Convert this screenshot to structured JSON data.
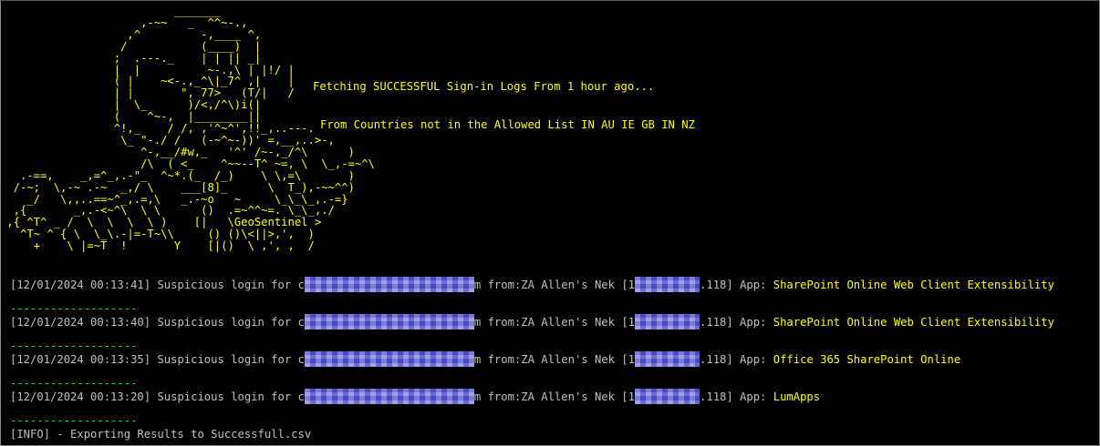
{
  "terminal": {
    "ascii_art": "                          _______\n                     ,-~~   _  ^^~-.,\n                   ,^         -,____ ^,\n                  /           (____)  |\n                 ;  .---._    | | || _|\n                 |  |          ~-.,\\ | |!/ |\n                 ( |    ~<-.,_^\\|_7^ ,|    |\n                 | |       \", 77>   (T/|   /\n                 |  \\_      )/<,/^\\)i(|\n                 (    ^~-,  |________||\n                 ^!,_    / /, ,'^~^',!!_,..---.\n                  \\_ \"-./ /   (-~^~-))' =,__,..>-,\n                     ^-,__/#w,_   '^' /~-,_/^\\      )\n                     /\\  ( <_    ^~~--T^ ~=, \\  \\_,-=~^\\\n   .-==,    _,=^_,.-\"_  ^~*.(_  /_)    \\ \\,=\\       )\n  /-~;  \\,-~ .-~  _,/ \\    ___[8]_      \\  T_),-~~^^)\n    _/   \\,,..==~^_,.=,\\   _.-~o   ~     \\_\\_\\_,.-=}\n  ,{       _,.-<~^\\  \\ \\      ()  .=~^^~=. \\_\\_,./\n ,{ ^T^ _ /  \\  \\  \\  \\ )    [|   \\GeoSentinel >\n   ^T~ ^ { \\  \\_\\.-|=-T~\\\\     () ()\\<||>,',  )\n     +    \\ |=~T  !       Y    [|()  \\ ,', ,  /",
    "header_line1": "Fetching SUCCESSFUL Sign-in Logs From 1 hour ago...",
    "header_line2": "From Countries not in the Allowed List IN AU IE GB IN NZ",
    "separator": "-------------------",
    "logs": [
      {
        "timestamp": "[12/01/2024 00:13:41]",
        "message": "Suspicious login for",
        "user_first": "c",
        "user_last": "m",
        "location": "from:ZA Allen's Nek",
        "ip_open": "[1",
        "ip_tail": ".118]",
        "app_label": "App:",
        "app": "SharePoint Online Web Client Extensibility"
      },
      {
        "timestamp": "[12/01/2024 00:13:40]",
        "message": "Suspicious login for",
        "user_first": "c",
        "user_last": "m",
        "location": "from:ZA Allen's Nek",
        "ip_open": "[1",
        "ip_tail": ".118]",
        "app_label": "App:",
        "app": "SharePoint Online Web Client Extensibility"
      },
      {
        "timestamp": "[12/01/2024 00:13:35]",
        "message": "Suspicious login for",
        "user_first": "c",
        "user_last": "m",
        "location": "from:ZA Allen's Nek",
        "ip_open": "[1",
        "ip_tail": ".118]",
        "app_label": "App:",
        "app": "Office 365 SharePoint Online"
      },
      {
        "timestamp": "[12/01/2024 00:13:20]",
        "message": "Suspicious login for",
        "user_first": "c",
        "user_last": "m",
        "location": "from:ZA Allen's Nek",
        "ip_open": "[1",
        "ip_tail": ".118]",
        "app_label": "App:",
        "app": "LumApps"
      }
    ],
    "info_line": "[INFO] - Exporting Results to Successfull.csv"
  },
  "colors": {
    "background": "#000000",
    "ascii_art": "#ffff00",
    "header_text": "#ffff00",
    "log_text": "#c0c0c0",
    "app_name": "#ffff00",
    "separator": "#00ff00",
    "redaction": "#6a6ade"
  }
}
